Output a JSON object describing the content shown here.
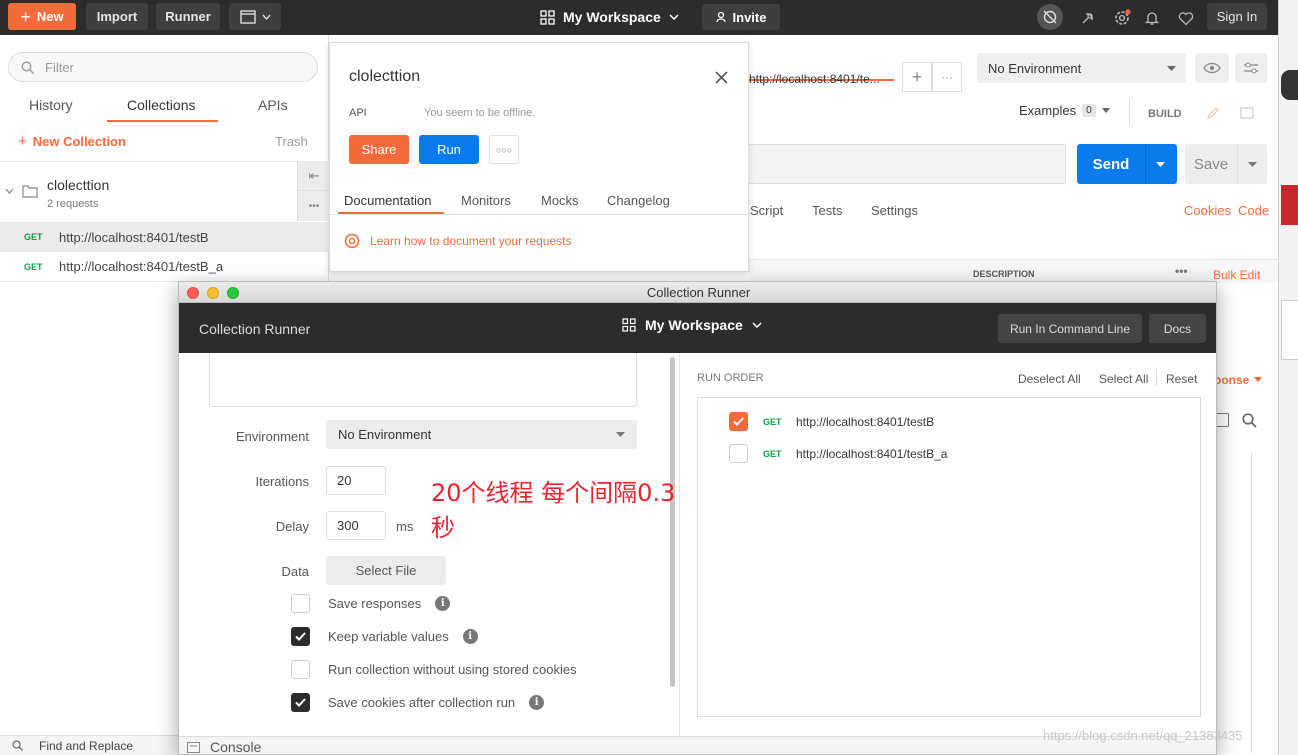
{
  "topbar": {
    "new_label": "New",
    "import_label": "Import",
    "runner_label": "Runner",
    "workspace": "My Workspace",
    "invite": "Invite",
    "signin": "Sign In"
  },
  "sidebar": {
    "filter_placeholder": "Filter",
    "tabs": [
      "History",
      "Collections",
      "APIs"
    ],
    "new_collection": "New Collection",
    "trash": "Trash",
    "collection_name": "clolecttion",
    "collection_count": "2 requests",
    "requests": [
      {
        "method": "GET",
        "url": "http://localhost:8401/testB"
      },
      {
        "method": "GET",
        "url": "http://localhost:8401/testB_a"
      }
    ]
  },
  "popover": {
    "title": "clolecttion",
    "api_label": "API",
    "offline": "You seem to be offline.",
    "share": "Share",
    "run": "Run",
    "tabs": [
      "Documentation",
      "Monitors",
      "Mocks",
      "Changelog"
    ],
    "learn": "Learn how to document your requests"
  },
  "main": {
    "tab_url": "http://localhost:8401/te...",
    "environment": "No Environment",
    "examples": "Examples",
    "examples_count": "0",
    "build": "BUILD",
    "send": "Send",
    "save": "Save",
    "subtabs": [
      "Script",
      "Tests",
      "Settings"
    ],
    "cookies": "Cookies",
    "code": "Code",
    "description_header": "DESCRIPTION",
    "bulk_edit": "Bulk Edit",
    "response_fragment": "ponse"
  },
  "runner": {
    "window_title": "Collection Runner",
    "header_title": "Collection Runner",
    "workspace": "My Workspace",
    "cmdline": "Run In Command Line",
    "docs": "Docs",
    "environment_label": "Environment",
    "environment_value": "No Environment",
    "iterations_label": "Iterations",
    "iterations_value": "20",
    "delay_label": "Delay",
    "delay_value": "300",
    "delay_unit": "ms",
    "data_label": "Data",
    "select_file": "Select File",
    "options": [
      {
        "label": "Save responses",
        "checked": false,
        "info": true
      },
      {
        "label": "Keep variable values",
        "checked": true,
        "info": true
      },
      {
        "label": "Run collection without using stored cookies",
        "checked": false,
        "info": false
      },
      {
        "label": "Save cookies after collection run",
        "checked": true,
        "info": true
      }
    ],
    "annotation": "20个线程 每个间隔0.3秒",
    "run_order": "RUN ORDER",
    "deselect_all": "Deselect All",
    "select_all": "Select All",
    "reset": "Reset",
    "order_items": [
      {
        "method": "GET",
        "url": "http://localhost:8401/testB",
        "checked": true
      },
      {
        "method": "GET",
        "url": "http://localhost:8401/testB_a",
        "checked": false
      }
    ]
  },
  "footer": {
    "find_replace": "Find and Replace",
    "console": "Console",
    "watermark": "https://blog.csdn.net/qq_21383435"
  },
  "colors": {
    "accent": "#f26b3a",
    "send_blue": "#097bed",
    "get_green": "#0a9e4a",
    "dark_bar": "#2c2c2c"
  }
}
